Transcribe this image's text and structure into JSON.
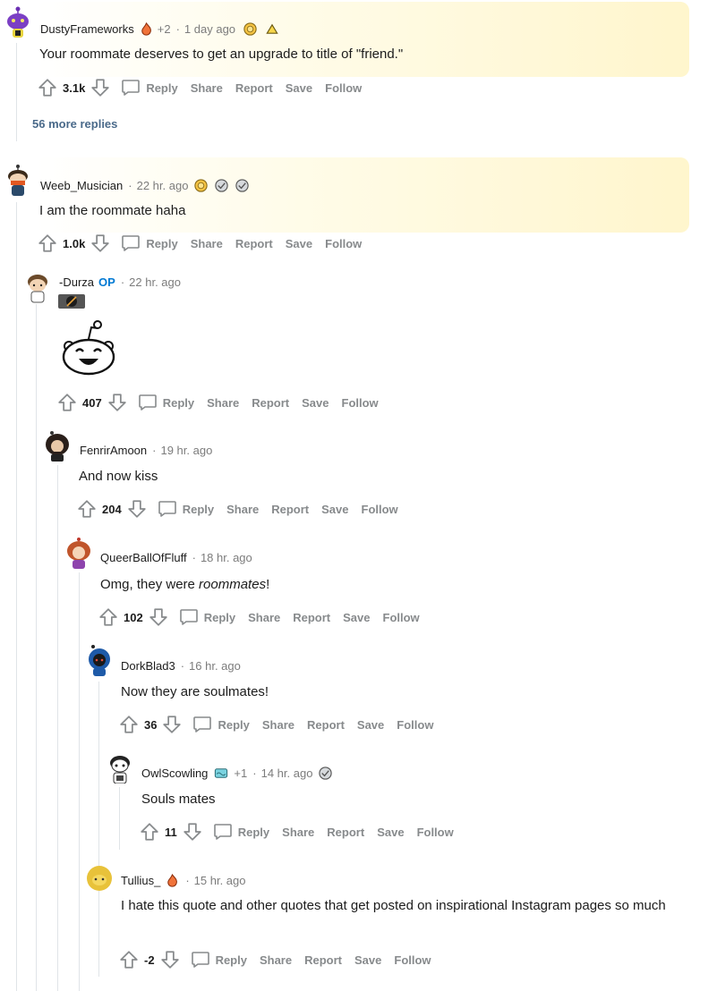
{
  "action_labels": {
    "reply": "Reply",
    "share": "Share",
    "report": "Report",
    "save": "Save",
    "follow": "Follow"
  },
  "more_replies": "56 more replies",
  "comments": [
    {
      "username": "DustyFrameworks",
      "award_count": "+2",
      "time": "1 day ago",
      "body": "Your roommate deserves to get an upgrade to title of \"friend.\"",
      "score": "3.1k"
    },
    {
      "username": "Weeb_Musician",
      "time": "22 hr. ago",
      "body": "I am the roommate haha",
      "score": "1.0k"
    },
    {
      "username": "-Durza",
      "flair": "OP",
      "time": "22 hr. ago",
      "score": "407"
    },
    {
      "username": "FenrirAmoon",
      "time": "19 hr. ago",
      "body": "And now kiss",
      "score": "204"
    },
    {
      "username": "QueerBallOfFluff",
      "time": "18 hr. ago",
      "body_before": "Omg, they were ",
      "body_em": "roommates",
      "body_after": "!",
      "score": "102"
    },
    {
      "username": "DorkBlad3",
      "time": "16 hr. ago",
      "body": "Now they are soulmates!",
      "score": "36"
    },
    {
      "username": "OwlScowling",
      "award_count": "+1",
      "time": "14 hr. ago",
      "body": "Souls mates",
      "score": "11"
    },
    {
      "username": "Tullius_",
      "time": "15 hr. ago",
      "body": "I hate this quote and other quotes that get posted on inspirational Instagram pages so much",
      "score": "-2"
    }
  ],
  "colors": {
    "muted": "#7c7c7c",
    "op": "#0079d3",
    "more_link": "#4a6a8a",
    "award_highlight": "#fff4c4",
    "thread_line": "#e0e4e8"
  }
}
